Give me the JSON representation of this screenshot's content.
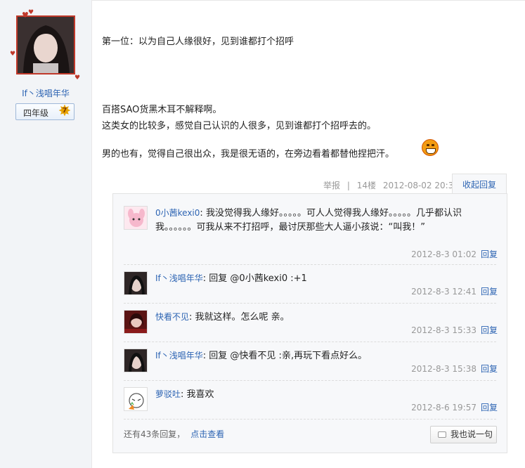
{
  "author": {
    "username": "If丶浅唱年华",
    "grade": "四年级",
    "level": "7"
  },
  "post": {
    "paragraphs": [
      "第一位：以为自己人缘很好，见到谁都打个招呼",
      "百搭SAO货黑木耳不解释啊。",
      "这类女的比较多，感觉自己认识的人很多，见到谁都打个招呼去的。",
      "男的也有，觉得自己很出众，我是很无语的，在旁边看着都替他捏把汗。"
    ],
    "emoji": "grin-emoji"
  },
  "meta": {
    "report": "举报",
    "separator": "|",
    "floor": "14楼",
    "time": "2012-08-02 20:38",
    "collapse_label": "收起回复"
  },
  "replies": [
    {
      "user": "0小茜kexi0",
      "sep": ":",
      "text": "我没觉得我人缘好。。。。。可人人觉得我人缘好。。。。。几乎都认识我。。。。。。可我从来不打招呼，最讨厌那些大人逼小孩说：“叫我！”",
      "time": "2012-8-3 01:02",
      "reply_label": "回复"
    },
    {
      "user": "If丶浅唱年华",
      "sep": ":",
      "text": "回复 @0小茜kexi0 :+1",
      "time": "2012-8-3 12:41",
      "reply_label": "回复"
    },
    {
      "user": "快看不见",
      "sep": ":",
      "text": "我就这样。怎么呢 亲。",
      "time": "2012-8-3 15:33",
      "reply_label": "回复"
    },
    {
      "user": "If丶浅唱年华",
      "sep": ":",
      "text": "回复 @快看不见 :亲,再玩下看点好么。",
      "time": "2012-8-3 15:38",
      "reply_label": "回复"
    },
    {
      "user": "萝驳吐",
      "sep": ":",
      "text": "我喜欢",
      "time": "2012-8-6 19:57",
      "reply_label": "回复"
    }
  ],
  "footer": {
    "more_text": "还有43条回复，",
    "more_link": "点击查看",
    "say_button": "我也说一句"
  },
  "colors": {
    "link": "#2d64b3",
    "avatar_border": "#c0392b",
    "reply_bg": "#f7f8fa",
    "sidebar_bg": "#f2f4f7"
  }
}
